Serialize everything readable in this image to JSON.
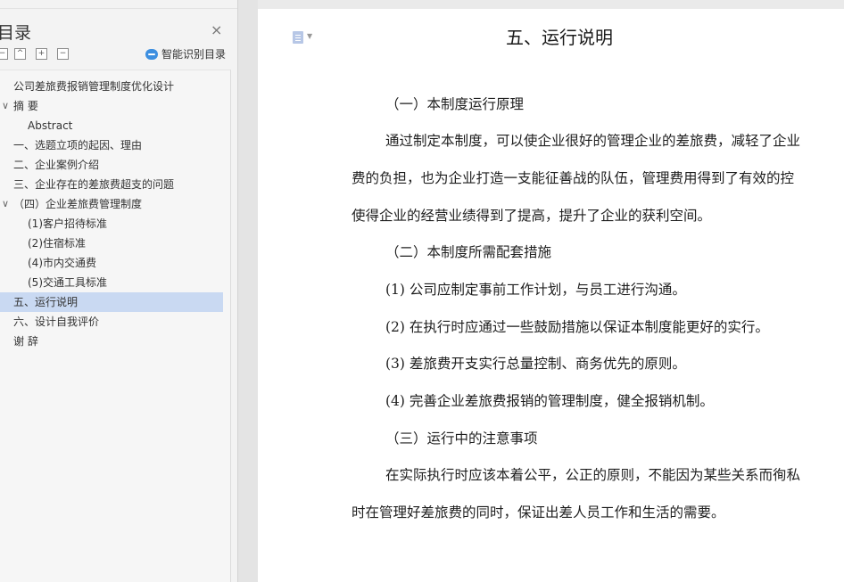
{
  "toc": {
    "title": "目录",
    "close_icon": "×",
    "tool_buttons": [
      "−",
      "^",
      "+",
      "−"
    ],
    "smart_label": "智能识别目录",
    "items": [
      {
        "label": "公司差旅费报销管理制度优化设计",
        "chevron": ""
      },
      {
        "label": "摘  要",
        "chevron": "∨"
      },
      {
        "label": "Abstract",
        "chevron": ""
      },
      {
        "label": "一、选题立项的起因、理由",
        "chevron": ""
      },
      {
        "label": "二、企业案例介绍",
        "chevron": ""
      },
      {
        "label": "三、企业存在的差旅费超支的问题",
        "chevron": ""
      },
      {
        "label": "（四）企业差旅费管理制度",
        "chevron": "∨"
      },
      {
        "label": "(1)客户招待标准",
        "chevron": ""
      },
      {
        "label": "(2)住宿标准",
        "chevron": ""
      },
      {
        "label": "(4)市内交通费",
        "chevron": ""
      },
      {
        "label": "(5)交通工具标准",
        "chevron": ""
      },
      {
        "label": "五、运行说明",
        "chevron": "",
        "selected": true
      },
      {
        "label": "六、设计自我评价",
        "chevron": ""
      },
      {
        "label": "谢  辞",
        "chevron": ""
      }
    ]
  },
  "document": {
    "heading": "五、运行说明",
    "paragraphs": [
      "（一）本制度运行原理",
      "通过制定本制度，可以使企业很好的管理企业的差旅费，减轻了企业",
      "费的负担，也为企业打造一支能征善战的队伍，管理费用得到了有效的控",
      "使得企业的经营业绩得到了提高，提升了企业的获利空间。",
      "（二）本制度所需配套措施",
      "(1) 公司应制定事前工作计划，与员工进行沟通。",
      "(2) 在执行时应通过一些鼓励措施以保证本制度能更好的实行。",
      "(3) 差旅费开支实行总量控制、商务优先的原则。",
      "(4) 完善企业差旅费报销的管理制度，健全报销机制。",
      "（三）运行中的注意事项",
      "在实际执行时应该本着公平，公正的原则，不能因为某些关系而徇私",
      "时在管理好差旅费的同时，保证出差人员工作和生活的需要。"
    ]
  },
  "colors": {
    "selected_item": "#c9d9f2",
    "panel_bg": "#f3f3f3",
    "accent": "#3d8fe0"
  }
}
